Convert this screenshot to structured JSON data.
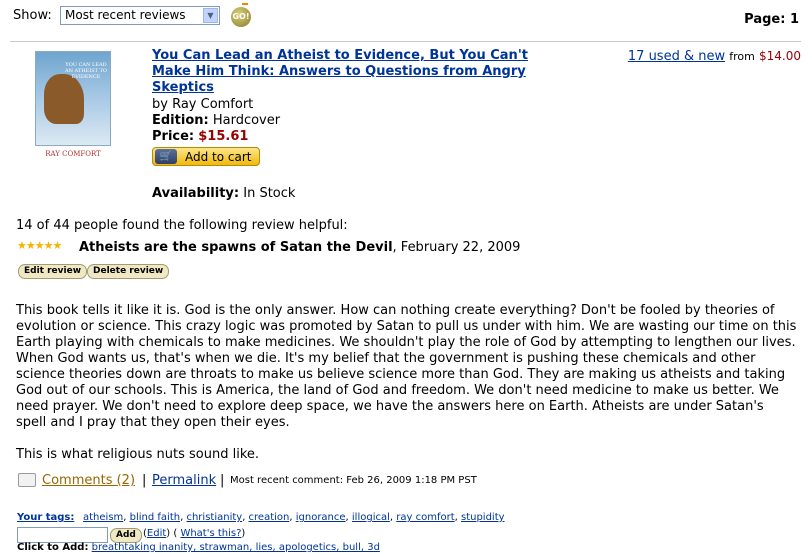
{
  "toolbar": {
    "show_label": "Show:",
    "sort_selected": "Most recent reviews",
    "go_label": "GO!",
    "page_label": "Page: 1"
  },
  "product": {
    "cover_title": "YOU CAN LEAD AN ATHEIST TO EVIDENCE",
    "cover_author": "RAY COMFORT",
    "title": "You Can Lead an Atheist to Evidence, But You Can't Make Him Think: Answers to Questions from Angry Skeptics",
    "by": "by Ray Comfort",
    "edition_label": "Edition:",
    "edition": "Hardcover",
    "price_label": "Price:",
    "price": "$15.61",
    "add_to_cart": "Add to cart",
    "availability_label": "Availability:",
    "availability": "In Stock",
    "used_new": "17 used & new",
    "from_label": "from",
    "from_price": "$14.00"
  },
  "review": {
    "helpful": "14 of 44 people found the following review helpful:",
    "rating_stars": 5,
    "title": "Atheists are the spawns of Satan the Devil",
    "date": ", February 22, 2009",
    "edit_label": "Edit review",
    "delete_label": "Delete review",
    "body": "This book tells it like it is. God is the only answer. How can nothing create everything? Don't be fooled by theories of evolution or science. This crazy logic was promoted by Satan to pull us under with him. We are wasting our time on this Earth playing with chemicals to make medicines. We shouldn't play the role of God by attempting to lengthen our lives. When God wants us, that's when we die. It's my belief that the government is pushing these chemicals and other science theories down are throats to make us believe science more than God. They are making us atheists and taking God out of our schools. This is America, the land of God and freedom. We don't need medicine to make us better. We need prayer. We don't need to explore deep space, we have the answers here on Earth. Atheists are under Satan's spell and I pray that they open their eyes.",
    "closing": "This is what religious nuts sound like.",
    "comments_link": "Comments (2)",
    "separator": "|",
    "permalink": "Permalink",
    "recent_comment": "Most recent comment: Feb 26, 2009 1:18 PM PST"
  },
  "tags": {
    "label": "Your tags:",
    "items": [
      "atheism",
      "blind faith",
      "christianity",
      "creation",
      "ignorance",
      "illogical",
      "ray comfort",
      "stupidity"
    ],
    "add_label": "Add",
    "edit_label": "Edit",
    "whats_this": "What's this?",
    "click_to_add_label": "Click to Add:",
    "suggested": "breathtaking inanity, strawman, lies, apologetics, bull, 3d"
  }
}
